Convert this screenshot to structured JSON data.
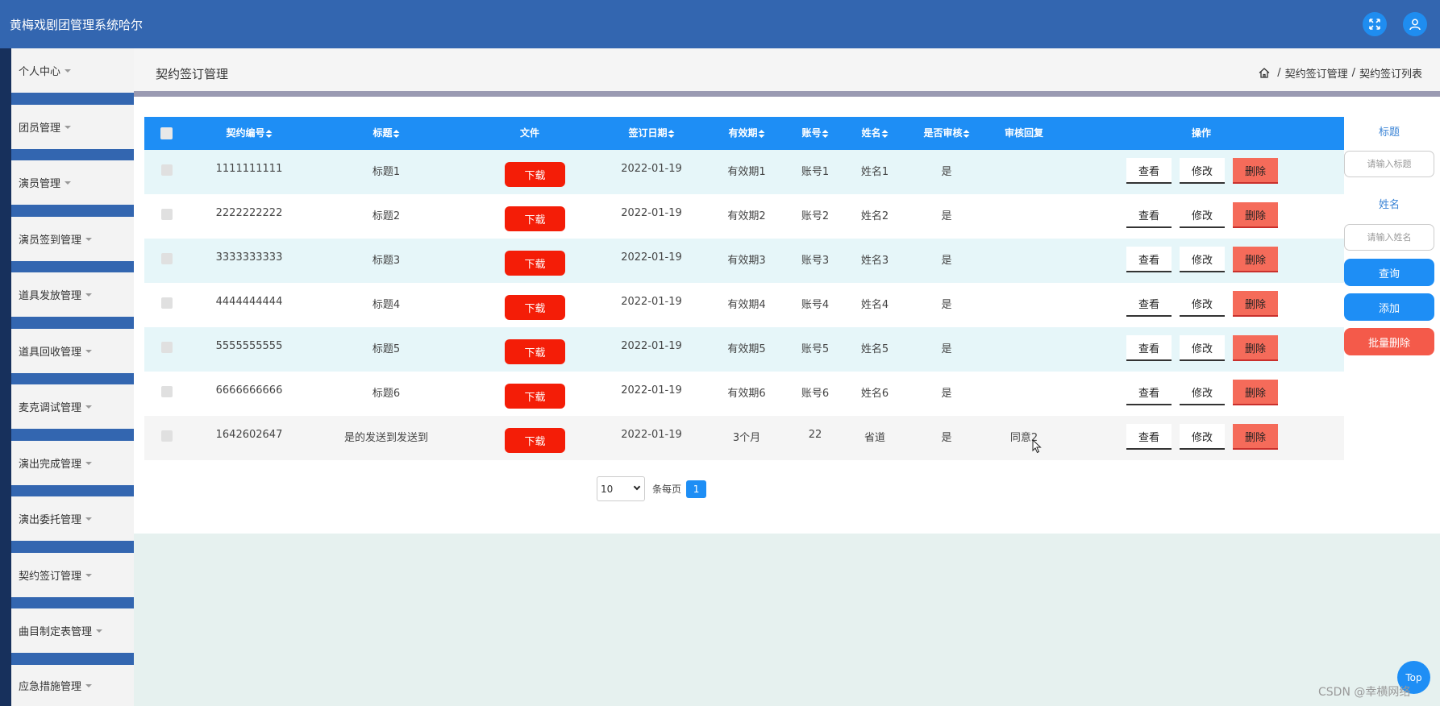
{
  "app": {
    "title": "黄梅戏剧团管理系统哈尔"
  },
  "sidebar": {
    "items": [
      {
        "label": "个人中心"
      },
      {
        "label": "团员管理"
      },
      {
        "label": "演员管理"
      },
      {
        "label": "演员签到管理"
      },
      {
        "label": "道具发放管理"
      },
      {
        "label": "道具回收管理"
      },
      {
        "label": "麦克调试管理"
      },
      {
        "label": "演出完成管理"
      },
      {
        "label": "演出委托管理"
      },
      {
        "label": "契约签订管理"
      },
      {
        "label": "曲目制定表管理"
      },
      {
        "label": "应急措施管理"
      }
    ]
  },
  "header": {
    "title": "契约签订管理",
    "breadcrumb": [
      "契约签订管理",
      "契约签订列表"
    ],
    "separator": "/"
  },
  "table": {
    "columns": [
      {
        "label": "契约编号",
        "sortable": true
      },
      {
        "label": "标题",
        "sortable": true
      },
      {
        "label": "文件",
        "sortable": false
      },
      {
        "label": "签订日期",
        "sortable": true
      },
      {
        "label": "有效期",
        "sortable": true
      },
      {
        "label": "账号",
        "sortable": true
      },
      {
        "label": "姓名",
        "sortable": true
      },
      {
        "label": "是否审核",
        "sortable": true
      },
      {
        "label": "审核回复",
        "sortable": false
      },
      {
        "label": "操作",
        "sortable": false
      }
    ],
    "download_label": "下载",
    "view_label": "查看",
    "edit_label": "修改",
    "delete_label": "删除",
    "rows": [
      {
        "id": "1111111111",
        "title": "标题1",
        "date": "2022-01-19",
        "validity": "有效期1",
        "account": "账号1",
        "name": "姓名1",
        "reviewed": "是",
        "reply": ""
      },
      {
        "id": "2222222222",
        "title": "标题2",
        "date": "2022-01-19",
        "validity": "有效期2",
        "account": "账号2",
        "name": "姓名2",
        "reviewed": "是",
        "reply": ""
      },
      {
        "id": "3333333333",
        "title": "标题3",
        "date": "2022-01-19",
        "validity": "有效期3",
        "account": "账号3",
        "name": "姓名3",
        "reviewed": "是",
        "reply": ""
      },
      {
        "id": "4444444444",
        "title": "标题4",
        "date": "2022-01-19",
        "validity": "有效期4",
        "account": "账号4",
        "name": "姓名4",
        "reviewed": "是",
        "reply": ""
      },
      {
        "id": "5555555555",
        "title": "标题5",
        "date": "2022-01-19",
        "validity": "有效期5",
        "account": "账号5",
        "name": "姓名5",
        "reviewed": "是",
        "reply": ""
      },
      {
        "id": "6666666666",
        "title": "标题6",
        "date": "2022-01-19",
        "validity": "有效期6",
        "account": "账号6",
        "name": "姓名6",
        "reviewed": "是",
        "reply": ""
      },
      {
        "id": "1642602647",
        "title": "是的发送到发送到",
        "date": "2022-01-19",
        "validity": "3个月",
        "account": "22",
        "name": "省道",
        "reviewed": "是",
        "reply": "同意2"
      }
    ]
  },
  "pagination": {
    "page_size": "10",
    "per_page_label": "条每页",
    "current_page": "1"
  },
  "filter": {
    "title_label": "标题",
    "title_placeholder": "请输入标题",
    "name_label": "姓名",
    "name_placeholder": "请输入姓名",
    "search_label": "查询",
    "add_label": "添加",
    "batch_delete_label": "批量删除"
  },
  "back_to_top": "Top",
  "watermark": "CSDN @幸横网络",
  "colors": {
    "topbar": "#3366b0",
    "primary": "#1e8ef5",
    "danger": "#f41d07",
    "delete": "#f56b5a"
  }
}
